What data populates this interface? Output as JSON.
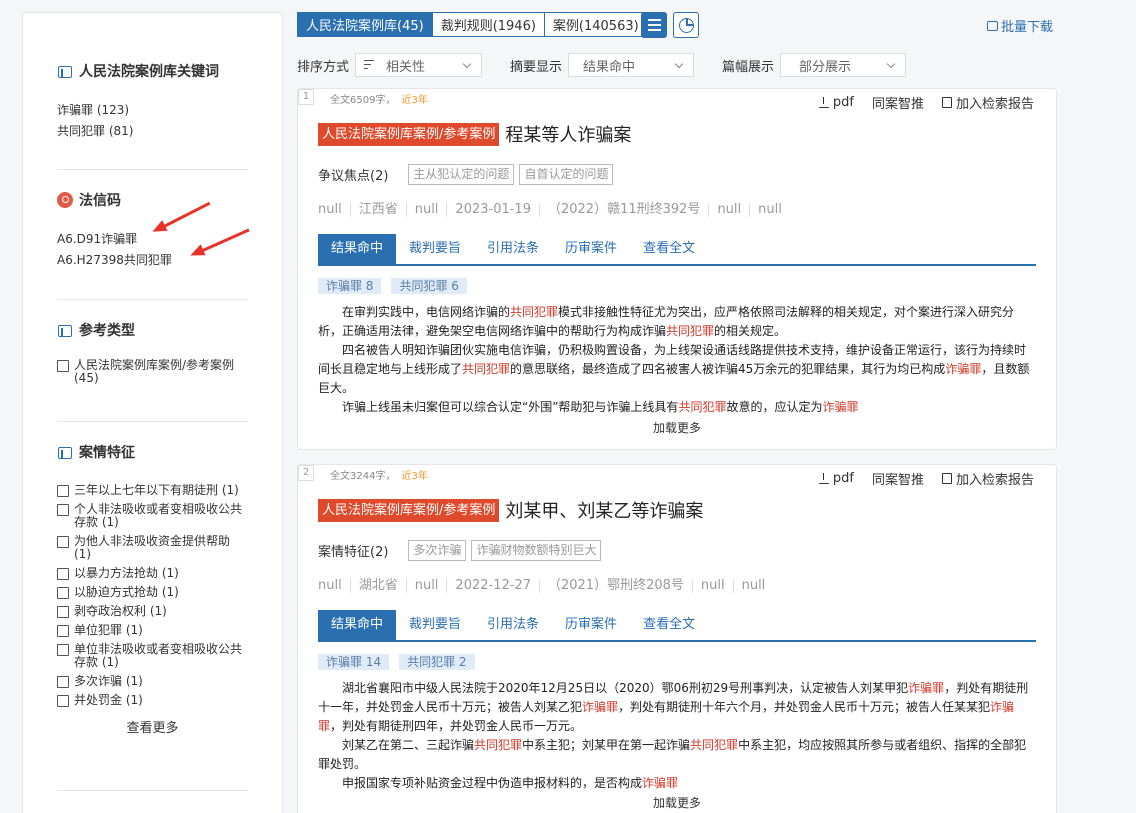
{
  "sidebar": {
    "keywords": {
      "title": "人民法院案例库关键词",
      "items": [
        "诈骗罪 (123)",
        "共同犯罪 (81)"
      ]
    },
    "faxinma": {
      "title": "法信码",
      "items": [
        "A6.D91诈骗罪",
        "A6.H27398共同犯罪"
      ]
    },
    "ref_type": {
      "title": "参考类型",
      "items": [
        "人民法院案例库案例/参考案例 (45)"
      ]
    },
    "features": {
      "title": "案情特征",
      "items": [
        "三年以上七年以下有期徒刑 (1)",
        "个人非法吸收或者变相吸收公共存款 (1)",
        "为他人非法吸收资金提供帮助 (1)",
        "以暴力方法抢劫 (1)",
        "以胁迫方式抢劫 (1)",
        "剥夺政治权利 (1)",
        "单位犯罪 (1)",
        "单位非法吸收或者变相吸收公共存款 (1)",
        "多次诈骗 (1)",
        "并处罚金 (1)"
      ],
      "see_more": "查看更多"
    }
  },
  "top_tabs": [
    "人民法院案例库(45)",
    "裁判规则(1946)",
    "案例(140563)"
  ],
  "icons": {
    "list_view": "list-icon",
    "chart_view": "pie-chart-icon",
    "download": "download-icon"
  },
  "batch_download": "批量下载",
  "sort": {
    "sort_label": "排序方式",
    "sort_value": "相关性",
    "summary_label": "摘要显示",
    "summary_value": "结果命中",
    "length_label": "篇幅展示",
    "length_value": "部分展示"
  },
  "card_actions": [
    "pdf",
    "同案智推",
    "加入检索报告"
  ],
  "card_tabs": [
    "结果命中",
    "裁判要旨",
    "引用法条",
    "历审案件",
    "查看全文"
  ],
  "load_more": "加载更多",
  "results": [
    {
      "num": "1",
      "word_count": "全文6509字，",
      "recent": "近3年",
      "tag": "人民法院案例库案例/参考案例",
      "title": "程某等人诈骗案",
      "focus_label": "争议焦点(2)",
      "chips": [
        "主从犯认定的问题",
        "自首认定的问题"
      ],
      "info": [
        "null",
        "江西省",
        "null",
        "2023-01-19",
        "（2022）赣11刑终392号",
        "null",
        "null"
      ],
      "hits": [
        "诈骗罪 8",
        "共同犯罪 6"
      ],
      "paras": [
        [
          "在审判实践中，电信网络诈骗的",
          "共同犯罪",
          "模式非接触性特征尤为突出，应严格依照司法解释的相关规定，对个案进行深入研究分析，正确适用法律，避免架空电信网络诈骗中的帮助行为构成诈骗",
          "共同犯罪",
          "的相关规定。"
        ],
        [
          "四名被告人明知诈骗团伙实施电信诈骗，仍积极购置设备，为上线架设通话线路提供技术支持，维护设备正常运行，该行为持续时间长且稳定地与上线形成了",
          "共同犯罪",
          "的意思联络，最终造成了四名被害人被诈骗45万余元的犯罪结果，其行为均已构成",
          "诈骗罪",
          "，且数额巨大。"
        ],
        [
          "诈骗上线虽未归案但可以综合认定“外围”帮助犯与诈骗上线具有",
          "共同犯罪",
          "故意的，应认定为",
          "诈骗罪",
          ""
        ]
      ]
    },
    {
      "num": "2",
      "word_count": "全文3244字，",
      "recent": "近3年",
      "tag": "人民法院案例库案例/参考案例",
      "title": "刘某甲、刘某乙等诈骗案",
      "focus_label": "案情特征(2)",
      "chips": [
        "多次诈骗",
        "诈骗财物数额特别巨大"
      ],
      "info": [
        "null",
        "湖北省",
        "null",
        "2022-12-27",
        "（2021）鄂刑终208号",
        "null",
        "null"
      ],
      "hits": [
        "诈骗罪 14",
        "共同犯罪 2"
      ],
      "paras": [
        [
          "湖北省襄阳市中级人民法院于2020年12月25日以（2020）鄂06刑初29号刑事判决，认定被告人刘某甲犯",
          "诈骗罪",
          "，判处有期徒刑十一年，并处罚金人民币十万元；被告人刘某乙犯",
          "诈骗罪",
          "，判处有期徒刑十年六个月，并处罚金人民币十万元；被告人任某某犯",
          "诈骗罪",
          "，判处有期徒刑四年，并处罚金人民币一万元。"
        ],
        [
          "刘某乙在第二、三起诈骗",
          "共同犯罪",
          "中系主犯；刘某甲在第一起诈骗",
          "共同犯罪",
          "中系主犯，均应按照其所参与或者组织、指挥的全部犯罪处罚。"
        ],
        [
          "申报国家专项补贴资金过程中伪造申报材料的，是否构成",
          "诈骗罪",
          ""
        ]
      ]
    }
  ]
}
